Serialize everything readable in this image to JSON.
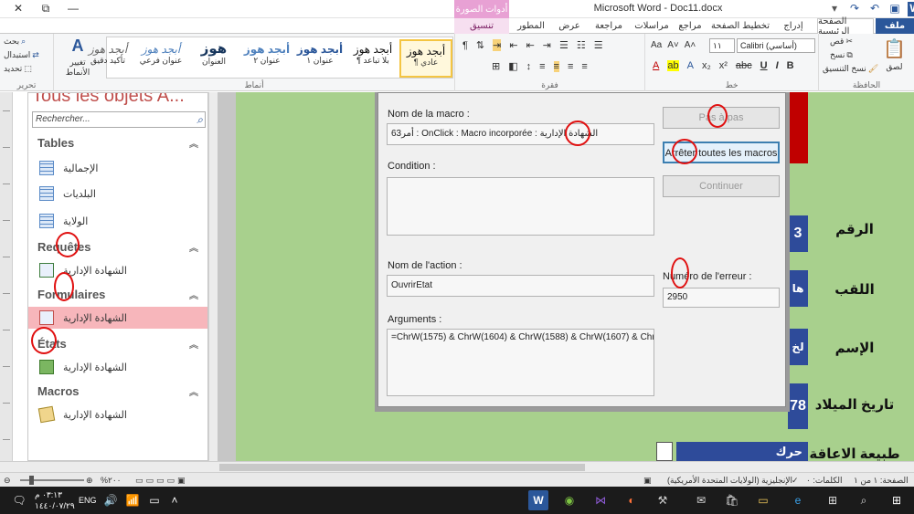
{
  "window": {
    "title": "Microsoft Word - Doc11.docx",
    "contextual_tab_group": "أدوات الصورة",
    "controls": {
      "minimize": "—",
      "restore": "⧉",
      "close": "✕"
    }
  },
  "ribbon_tabs": [
    {
      "label": "ملف"
    },
    {
      "label": "الصفحة الرئيسية"
    },
    {
      "label": "إدراج"
    },
    {
      "label": "تخطيط الصفحة"
    },
    {
      "label": "مراجع"
    },
    {
      "label": "مراسلات"
    },
    {
      "label": "مراجعة"
    },
    {
      "label": "عرض"
    },
    {
      "label": "المطور"
    },
    {
      "label": "تنسيق"
    }
  ],
  "ribbon": {
    "clipboard": {
      "label": "الحافظة",
      "paste": "لصق",
      "cut": "قص",
      "copy": "نسخ",
      "format_painter": "نسخ التنسيق"
    },
    "font": {
      "label": "خط",
      "font_name": "Calibri (أساسي)",
      "font_size": "١١"
    },
    "paragraph": {
      "label": "فقرة"
    },
    "styles": {
      "label": "أنماط",
      "items": [
        {
          "sample": "أبجد هوز",
          "name": "¶ عادي"
        },
        {
          "sample": "أبجد هوز",
          "name": "¶ بلا تباعد"
        },
        {
          "sample": "أبجد هوز",
          "name": "عنوان ١"
        },
        {
          "sample": "أبجد هوز",
          "name": "عنوان ٢"
        },
        {
          "sample": "هوز",
          "name": "العنوان"
        },
        {
          "sample": "أبجد هوز",
          "name": "عنوان فرعي"
        },
        {
          "sample": "أبجد هوز",
          "name": "تأكيد دقيق"
        }
      ],
      "change_styles": "تغيير الأنماط"
    },
    "editing": {
      "label": "تحرير",
      "find": "بحث",
      "replace": "استبدال",
      "select": "تحديد"
    }
  },
  "nav_pane": {
    "title": "Tous les objets A...",
    "search_placeholder": "Rechercher...",
    "sections": [
      {
        "header": "Tables",
        "items": [
          "الإجمالية",
          "البلديات",
          "الولاية"
        ]
      },
      {
        "header": "Requêtes",
        "items": [
          "الشهادة الإدارية"
        ]
      },
      {
        "header": "Formulaires",
        "items": [
          "الشهادة الإدارية"
        ]
      },
      {
        "header": "États",
        "items": [
          "الشهادة الإدارية"
        ]
      },
      {
        "header": "Macros",
        "items": [
          "الشهادة الإدارية"
        ]
      }
    ]
  },
  "macro_dialog": {
    "macro_name_label": "Nom de la macro :",
    "macro_name_value": "الشهادة الإدارية : OnClick : Macro incorporée : أمر63",
    "condition_label": "Condition :",
    "condition_value": "",
    "action_name_label": "Nom de l'action :",
    "action_name_value": "OuvrirEtat",
    "arguments_label": "Arguments :",
    "arguments_value": "=ChrW(1575) & ChrW(1604) & ChrW(1588) & ChrW(1607) & ChrW(",
    "error_number_label": "Numéro de l'erreur :",
    "error_number_value": "2950",
    "buttons": {
      "step": "Pas à pas",
      "stop_all": "Arrêter toutes les macros",
      "continue": "Continuer"
    }
  },
  "document": {
    "labels": [
      "الرقم",
      "اللقب",
      "الإسم",
      "تاريخ الميلاد",
      "طبيعة الاعاقة"
    ],
    "cells": [
      "3",
      "ها",
      "لخ",
      "78",
      "حرك"
    ]
  },
  "statusbar": {
    "page": "الصفحة: ١ من ١",
    "words": "الكلمات: ٠",
    "language": "الإنجليزية (الولايات المتحدة الأمريكية)",
    "zoom": "%٢٠٠"
  },
  "taskbar": {
    "language": "ENG",
    "time": "٠٣:١٣ م",
    "date": "١٤٤٠/٠٧/٢٩"
  }
}
